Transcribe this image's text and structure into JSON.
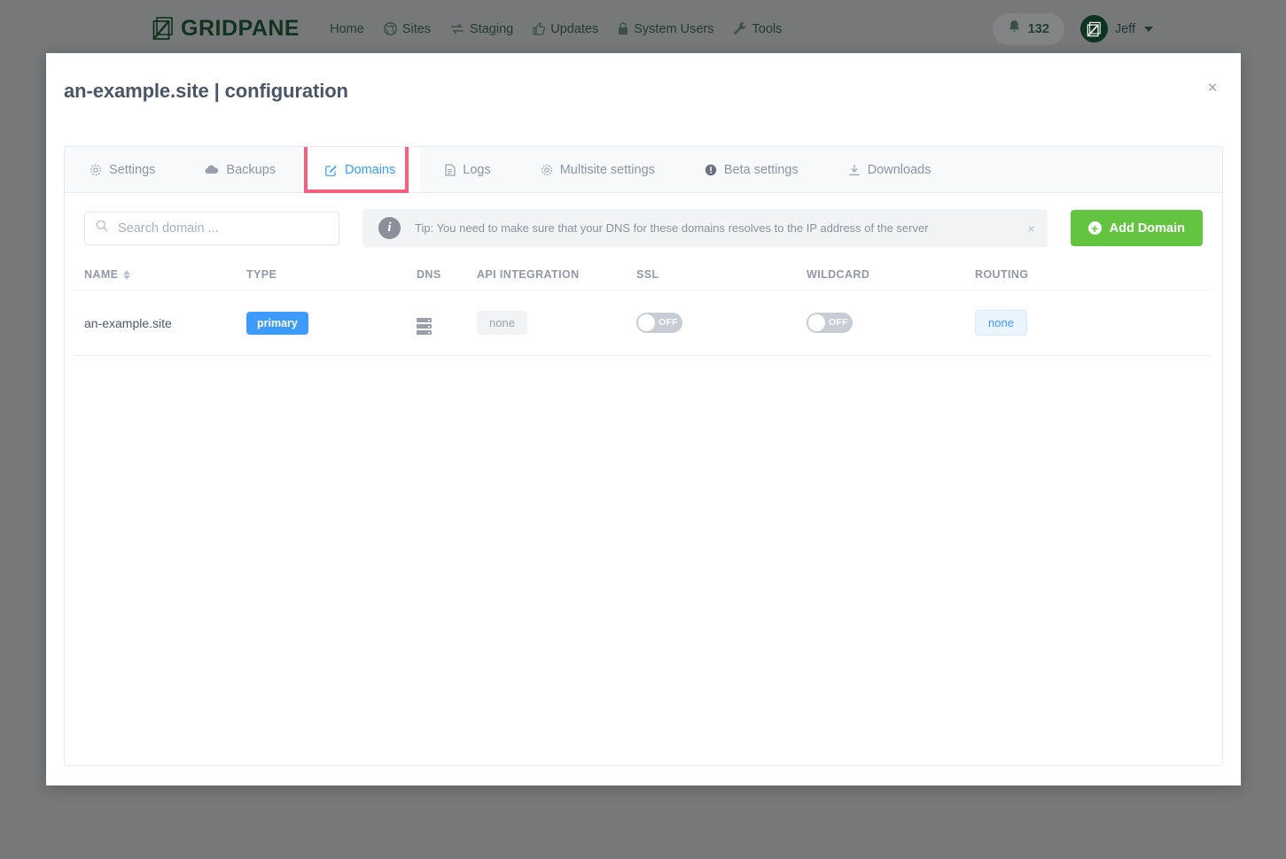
{
  "topnav": {
    "logo_text": "GRIDPANE",
    "logo_icon": "gridpane-logo-icon",
    "links": [
      {
        "label": "Home",
        "icon": ""
      },
      {
        "label": "Sites",
        "icon": "wordpress-icon"
      },
      {
        "label": "Staging",
        "icon": "sync-icon"
      },
      {
        "label": "Updates",
        "icon": "thumbs-up-icon"
      },
      {
        "label": "System Users",
        "icon": "lock-icon"
      },
      {
        "label": "Tools",
        "icon": "wrench-icon"
      }
    ],
    "notifications": {
      "icon": "bell-icon",
      "count": "132"
    },
    "user": {
      "name": "Jeff",
      "avatar_icon": "user-avatar-icon",
      "caret_icon": "chevron-down-icon"
    }
  },
  "modal": {
    "title": "an-example.site | configuration",
    "close_icon": "close-icon",
    "close_label": "×"
  },
  "tabs": [
    {
      "label": "Settings",
      "icon": "gear-icon",
      "active": false
    },
    {
      "label": "Backups",
      "icon": "cloud-icon",
      "active": false
    },
    {
      "label": "Domains",
      "icon": "edit-square-icon",
      "active": true
    },
    {
      "label": "Logs",
      "icon": "document-icon",
      "active": false
    },
    {
      "label": "Multisite settings",
      "icon": "gear-icon",
      "active": false
    },
    {
      "label": "Beta settings",
      "icon": "exclamation-circle-icon",
      "active": false
    },
    {
      "label": "Downloads",
      "icon": "download-icon",
      "active": false
    }
  ],
  "toolbar": {
    "search": {
      "placeholder": "Search domain ...",
      "value": "",
      "icon": "search-icon"
    },
    "tip": {
      "icon": "info-icon",
      "text": "Tip: You need to make sure that your DNS for these domains resolves to the IP address of the server",
      "close_label": "×"
    },
    "add_button": {
      "label": "Add Domain",
      "icon": "plus-circle-icon"
    }
  },
  "table": {
    "columns": [
      "NAME",
      "TYPE",
      "DNS",
      "API INTEGRATION",
      "SSL",
      "WILDCARD",
      "ROUTING"
    ],
    "sort_icon": "sort-arrows-icon",
    "rows": [
      {
        "name": "an-example.site",
        "type": "primary",
        "dns_icon": "server-stack-icon",
        "api_integration": "none",
        "ssl": "OFF",
        "wildcard": "OFF",
        "routing": "none"
      }
    ]
  },
  "colors": {
    "nav_bg": "#76787a",
    "accent_blue": "#3d9bfc",
    "green": "#63c440",
    "highlight_pink": "#f9607f",
    "logo_green": "#10321f"
  }
}
